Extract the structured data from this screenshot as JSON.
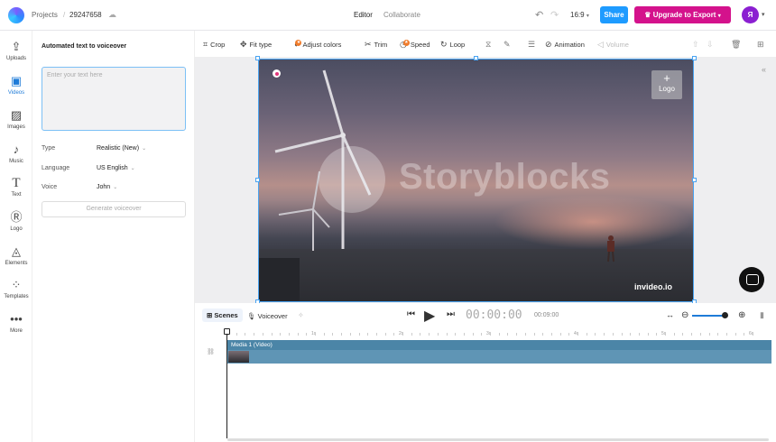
{
  "header": {
    "projects_label": "Projects",
    "separator": "/",
    "project_id": "29247658",
    "tabs": [
      "Editor",
      "Collaborate"
    ],
    "aspect_ratio": "16:9",
    "share_label": "Share",
    "upgrade_label": "Upgrade to Export",
    "avatar_initial": "Я",
    "colors": {
      "share": "#1e9bff",
      "upgrade": "#d4128c",
      "avatar": "#8b1fd1"
    }
  },
  "sidebar": {
    "items": [
      {
        "label": "Uploads",
        "icon": "upload-icon"
      },
      {
        "label": "Videos",
        "icon": "video-icon"
      },
      {
        "label": "Images",
        "icon": "image-icon"
      },
      {
        "label": "Music",
        "icon": "music-icon"
      },
      {
        "label": "Text",
        "icon": "text-icon"
      },
      {
        "label": "Logo",
        "icon": "logo-icon"
      },
      {
        "label": "Elements",
        "icon": "elements-icon"
      },
      {
        "label": "Templates",
        "icon": "templates-icon"
      },
      {
        "label": "More",
        "icon": "more-icon"
      }
    ],
    "active": "Videos"
  },
  "panel": {
    "title": "Automated text to voiceover",
    "placeholder": "Enter your text here",
    "fields": [
      {
        "label": "Type",
        "value": "Realistic (New)"
      },
      {
        "label": "Language",
        "value": "US English"
      },
      {
        "label": "Voice",
        "value": "John"
      }
    ],
    "generate_label": "Generate voiceover"
  },
  "toolbar": {
    "crop": "Crop",
    "fit_type": "Fit type",
    "adjust_colors": "Adjust colors",
    "trim": "Trim",
    "speed": "Speed",
    "loop": "Loop",
    "animation": "Animation",
    "volume": "Volume"
  },
  "canvas": {
    "watermark": "Storyblocks",
    "logo_placeholder": "Logo",
    "brand": "invideo.io"
  },
  "timeline": {
    "scenes_label": "Scenes",
    "voiceover_label": "Voiceover",
    "current_time": "00:00:00",
    "total_time": "00:09:00",
    "ruler_labels": [
      "1s",
      "2s",
      "3s",
      "4s",
      "5s",
      "6s"
    ],
    "clip_label": "Media 1 (Video)"
  }
}
